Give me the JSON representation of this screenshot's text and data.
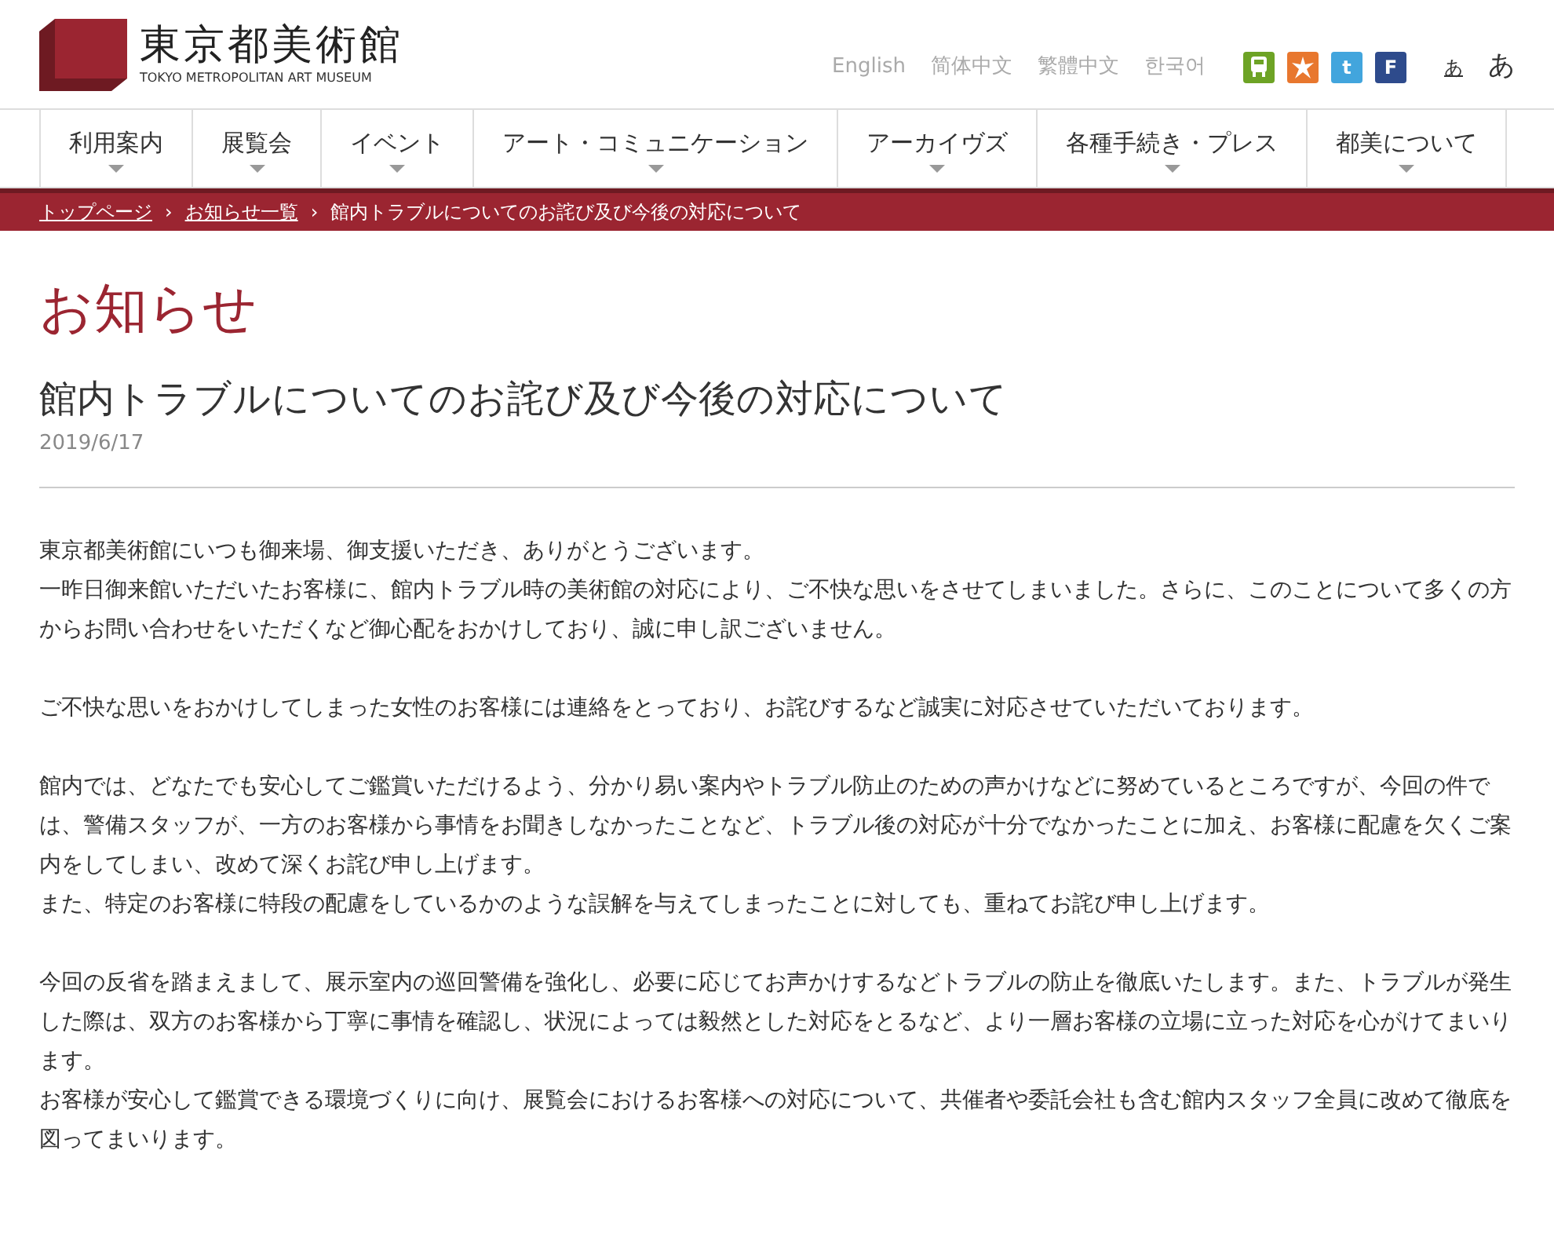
{
  "logo": {
    "name": "東京都美術館",
    "subtitle": "TOKYO METROPOLITAN ART MUSEUM"
  },
  "languages": [
    "English",
    "简体中文",
    "繁體中文",
    "한국어"
  ],
  "social": [
    {
      "kind": "bus",
      "color": "#6da325"
    },
    {
      "kind": "splash",
      "color": "#e8772e"
    },
    {
      "kind": "twitter",
      "color": "#42a5dd",
      "label": "t"
    },
    {
      "kind": "facebook",
      "color": "#2e4b8c",
      "label": "F"
    }
  ],
  "font_size": [
    {
      "label": "あ",
      "kind": "small",
      "selected": true
    },
    {
      "label": "あ",
      "kind": "large",
      "selected": false
    }
  ],
  "nav": [
    "利用案内",
    "展覧会",
    "イベント",
    "アート・コミュニケーション",
    "アーカイヴズ",
    "各種手続き・プレス",
    "都美について"
  ],
  "breadcrumb_separator": "›",
  "breadcrumb": [
    {
      "label": "トップページ",
      "link": true
    },
    {
      "label": "お知らせ一覧",
      "link": true
    },
    {
      "label": "館内トラブルについてのお詫び及び今後の対応について",
      "link": false
    }
  ],
  "section_title": "お知らせ",
  "article": {
    "title": "館内トラブルについてのお詫び及び今後の対応について",
    "date": "2019/6/17",
    "paragraphs": [
      [
        "東京都美術館にいつも御来場、御支援いただき、ありがとうございます。",
        "一昨日御来館いただいたお客様に、館内トラブル時の美術館の対応により、ご不快な思いをさせてしまいました。さらに、このことについて多くの方からお問い合わせをいただくなど御心配をおかけしており、誠に申し訳ございません。"
      ],
      [
        "ご不快な思いをおかけしてしまった女性のお客様には連絡をとっており、お詫びするなど誠実に対応させていただいております。"
      ],
      [
        "館内では、どなたでも安心してご鑑賞いただけるよう、分かり易い案内やトラブル防止のための声かけなどに努めているところですが、今回の件では、警備スタッフが、一方のお客様から事情をお聞きしなかったことなど、トラブル後の対応が十分でなかったことに加え、お客様に配慮を欠くご案内をしてしまい、改めて深くお詫び申し上げます。",
        "また、特定のお客様に特段の配慮をしているかのような誤解を与えてしまったことに対しても、重ねてお詫び申し上げます。"
      ],
      [
        "今回の反省を踏まえまして、展示室内の巡回警備を強化し、必要に応じてお声かけするなどトラブルの防止を徹底いたします。また、トラブルが発生した際は、双方のお客様から丁寧に事情を確認し、状況によっては毅然とした対応をとるなど、より一層お客様の立場に立った対応を心がけてまいります。",
        "お客様が安心して鑑賞できる環境づくりに向け、展覧会におけるお客様への対応について、共催者や委託会社も含む館内スタッフ全員に改めて徹底を図ってまいります。"
      ]
    ]
  }
}
